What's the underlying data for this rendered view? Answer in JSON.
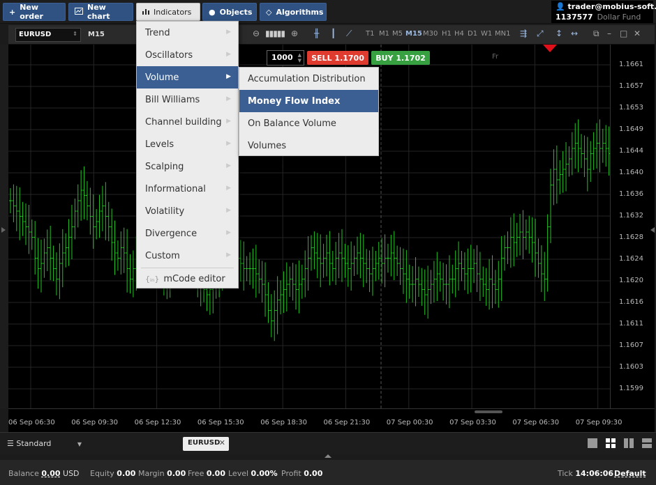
{
  "toolbar": {
    "new_order": "New order",
    "new_chart": "New chart",
    "indicators": "Indicators",
    "objects": "Objects",
    "algorithms": "Algorithms"
  },
  "account": {
    "user": "trader@mobius-soft.org",
    "number": "1137577",
    "fund": "Dollar Fund"
  },
  "chart_toolbar": {
    "symbol": "EURUSD",
    "timeframe": "M15",
    "periods": [
      "T1",
      "M1",
      "M5",
      "M15",
      "M30",
      "H1",
      "H4",
      "D1",
      "W1",
      "MN1"
    ],
    "selected_period": "M15"
  },
  "trade": {
    "quantity": "1000",
    "sell": "SELL 1.1700",
    "buy": "BUY 1.1702",
    "session_label": "Fr"
  },
  "indicators_menu": {
    "items": [
      {
        "label": "Trend"
      },
      {
        "label": "Oscillators"
      },
      {
        "label": "Volume"
      },
      {
        "label": "Bill Williams"
      },
      {
        "label": "Channel building"
      },
      {
        "label": "Levels"
      },
      {
        "label": "Scalping"
      },
      {
        "label": "Informational"
      },
      {
        "label": "Volatility"
      },
      {
        "label": "Divergence"
      },
      {
        "label": "Custom"
      }
    ],
    "editor": "mCode editor",
    "highlighted": "Volume"
  },
  "volume_submenu": {
    "items": [
      {
        "label": "Accumulation Distribution"
      },
      {
        "label": "Money Flow Index"
      },
      {
        "label": "On Balance Volume"
      },
      {
        "label": "Volumes"
      }
    ],
    "highlighted": "Money Flow Index"
  },
  "y_axis": [
    "1.1661",
    "1.1657",
    "1.1653",
    "1.1649",
    "1.1644",
    "1.1640",
    "1.1636",
    "1.1632",
    "1.1628",
    "1.1624",
    "1.1620",
    "1.1616",
    "1.1611",
    "1.1607",
    "1.1603",
    "1.1599"
  ],
  "x_axis": [
    "06 Sep 06:30",
    "06 Sep 09:30",
    "06 Sep 12:30",
    "06 Sep 15:30",
    "06 Sep 18:30",
    "06 Sep 21:30",
    "07 Sep 00:30",
    "07 Sep 03:30",
    "07 Sep 06:30",
    "07 Sep 09:30"
  ],
  "tabs": {
    "layout": "Standard",
    "chart_tab": "EURUSD"
  },
  "status": {
    "balance_label": "Balance",
    "balance": "0.00",
    "currency": "USD",
    "equity_label": "Equity",
    "equity": "0.00",
    "margin_label": "Margin",
    "margin": "0.00",
    "free_label": "Free",
    "free": "0.00",
    "level_label": "Level",
    "level": "0.00%",
    "profit_label": "Profit",
    "profit": "0.00",
    "tick_label": "Tick",
    "tick": "14:06:06",
    "profile": "Default"
  },
  "colors": {
    "accent": "#3b5f93",
    "sell": "#e03b2f",
    "buy": "#37a041",
    "bars": "#22c422"
  },
  "chart_data": {
    "type": "ohlc",
    "ylim": [
      1.1597,
      1.1664
    ],
    "close": [
      1.1635,
      1.1634,
      1.1633,
      1.1632,
      1.1631,
      1.163,
      1.1629,
      1.1628,
      1.1624,
      1.1622,
      1.1623,
      1.1625,
      1.1626,
      1.1624,
      1.1622,
      1.162,
      1.1623,
      1.1625,
      1.1626,
      1.1628,
      1.163,
      1.1633,
      1.1635,
      1.1637,
      1.1636,
      1.1634,
      1.1632,
      1.163,
      1.1631,
      1.1633,
      1.1634,
      1.1632,
      1.163,
      1.1627,
      1.1625,
      1.1624,
      1.1626,
      1.1625,
      1.1622,
      1.162,
      1.1622,
      1.1624,
      1.1628,
      1.163,
      1.1631,
      1.163,
      1.1628,
      1.1626,
      1.1624,
      1.1622,
      1.162,
      1.1621,
      1.1623,
      1.1625,
      1.1627,
      1.1628,
      1.1627,
      1.1625,
      1.1624,
      1.1623,
      1.1622,
      1.162,
      1.1619,
      1.1618,
      1.1617,
      1.1618,
      1.1619,
      1.162,
      1.1622,
      1.1623,
      1.1625,
      1.1626,
      1.1627,
      1.1625,
      1.1624,
      1.1623,
      1.1622,
      1.1622,
      1.1622,
      1.1622,
      1.1621,
      1.162,
      1.1619,
      1.1617,
      1.1614,
      1.1612,
      1.1614,
      1.1616,
      1.1617,
      1.1618,
      1.1619,
      1.162,
      1.1619,
      1.1618,
      1.1619,
      1.162,
      1.1622,
      1.1624,
      1.1626,
      1.1625,
      1.1624,
      1.1623,
      1.1624,
      1.1625,
      1.1623,
      1.1622,
      1.1624,
      1.1625,
      1.1624,
      1.1623,
      1.1622,
      1.1623,
      1.1624,
      1.1625,
      1.1624,
      1.1623,
      1.1622,
      1.1621,
      1.1622,
      1.1623,
      1.1624,
      1.1623,
      1.1624,
      1.1624,
      1.1625,
      1.1624,
      1.1623,
      1.1622,
      1.1621,
      1.162,
      1.1619,
      1.1619,
      1.162,
      1.1619,
      1.1618,
      1.1617,
      1.1618,
      1.1619,
      1.162,
      1.1621,
      1.162,
      1.1619,
      1.1619,
      1.162,
      1.162,
      1.1622,
      1.1623,
      1.1622,
      1.1621,
      1.1622,
      1.1622,
      1.1623,
      1.1621,
      1.162,
      1.1619,
      1.1618,
      1.162,
      1.1619,
      1.1618,
      1.162,
      1.1624,
      1.1626,
      1.1626,
      1.1628,
      1.1627,
      1.1628,
      1.1629,
      1.1628,
      1.1629,
      1.1628,
      1.1627,
      1.1625,
      1.1623,
      1.1621,
      1.162,
      1.163,
      1.1638,
      1.1641,
      1.1639,
      1.164,
      1.1641,
      1.1642,
      1.1643,
      1.1645,
      1.1646,
      1.1645,
      1.1644,
      1.1643,
      1.1641,
      1.1644,
      1.1645,
      1.1646,
      1.1645,
      1.1646,
      1.1645,
      1.1644
    ]
  }
}
